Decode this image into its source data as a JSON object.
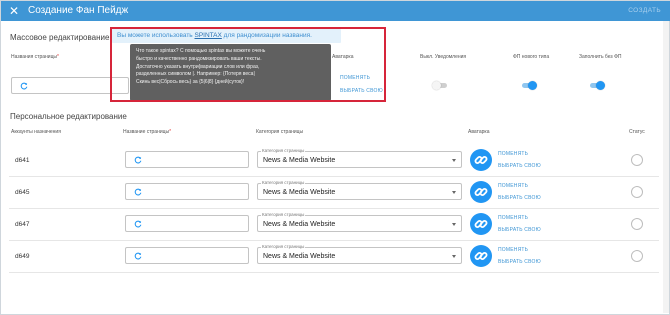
{
  "header": {
    "close_icon": "close-icon",
    "title": "Создание Фан Пейдж",
    "create_label": "СОЗДАТЬ"
  },
  "mass": {
    "section_title": "Массовое редактирование",
    "hint_prefix": "Вы можете использовать",
    "hint_link": "SPINTAX",
    "hint_suffix": "для рандомизации названия.",
    "tooltip_lines": [
      "Что такое spintax? С помощью spintax вы можете очень",
      "быстро и качественно рандомизировать ваши тексты.",
      "Достаточно указать внутри{вариации слов или фраз,",
      "разделенных символом |. Например: {Потеря веса|",
      "Скинь вес|Сбрось весь} за {5|6|8} {дней|суток}!"
    ],
    "headers": {
      "page_names": "Названия страницы",
      "avatar": "Аватарка",
      "notifications": "Выкл. Уведомления",
      "new_type": "ФП нового типа",
      "fill_without": "Заполнить без ФП"
    },
    "change_label": "ПОМЕНЯТЬ",
    "choose_label": "ВЫБРАТЬ СВОЮ",
    "toggles": {
      "notifications": false,
      "new_type": true,
      "fill_without": true
    }
  },
  "personal": {
    "section_title": "Персональное редактирование",
    "headers": {
      "accounts": "Аккаунты назначения",
      "page_name": "Название страницы",
      "category": "Категория страницы",
      "avatar": "Аватарка",
      "status": "Статус"
    },
    "rows": [
      {
        "account": "d641",
        "category_label": "Категория страницы",
        "category": "News & Media Website",
        "change": "ПОМЕНЯТЬ",
        "choose": "ВЫБРАТЬ СВОЮ"
      },
      {
        "account": "d645",
        "category_label": "Категория страницы",
        "category": "News & Media Website",
        "change": "ПОМЕНЯТЬ",
        "choose": "ВЫБРАТЬ СВОЮ"
      },
      {
        "account": "d647",
        "category_label": "Категория страницы",
        "category": "News & Media Website",
        "change": "ПОМЕНЯТЬ",
        "choose": "ВЫБРАТЬ СВОЮ"
      },
      {
        "account": "d649",
        "category_label": "Категория страницы",
        "category": "News & Media Website",
        "change": "ПОМЕНЯТЬ",
        "choose": "ВЫБРАТЬ СВОЮ"
      }
    ]
  },
  "colors": {
    "accent": "#3f96d5",
    "highlight_border": "#d6253a",
    "tooltip_bg": "#606060",
    "hint_bg": "#e3f1fb"
  }
}
